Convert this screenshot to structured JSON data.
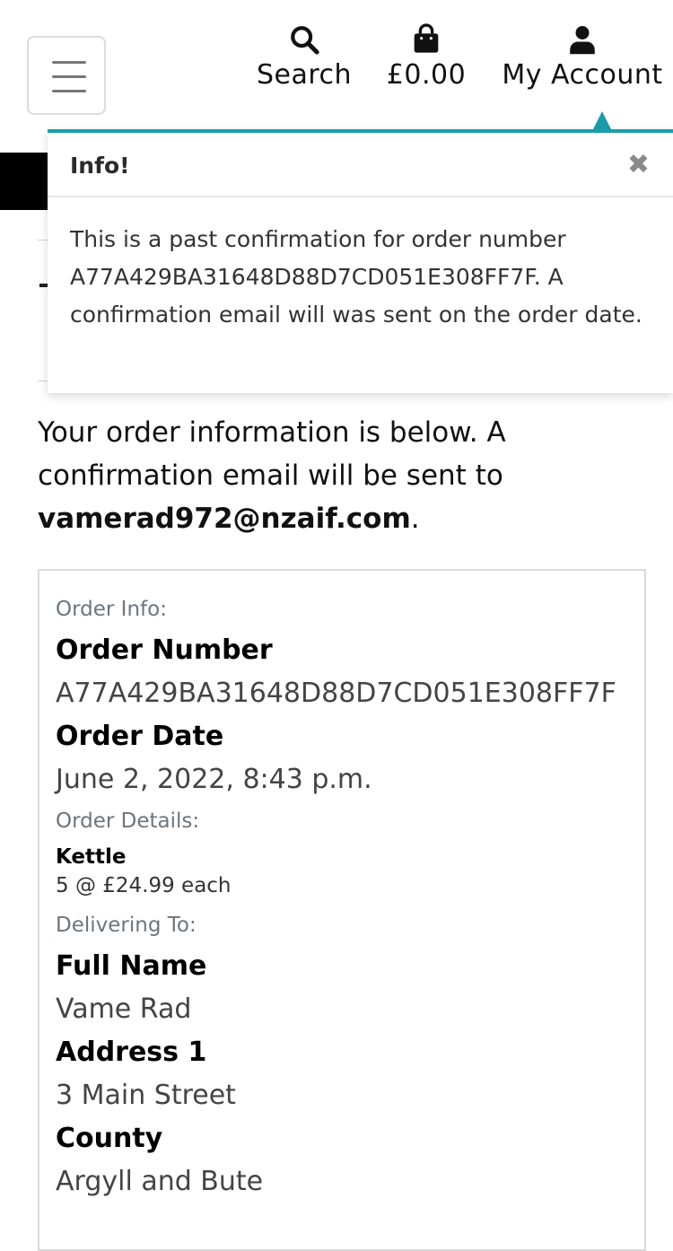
{
  "header": {
    "search_label": "Search",
    "bag_total": "£0.00",
    "account_label": "My Account"
  },
  "toast": {
    "title": "Info!",
    "close_glyph": "✖",
    "message": "This is a past confirmation for order number A77A429BA31648D88D7CD051E308FF7F. A confirmation email will was sent on the order date."
  },
  "intro": {
    "text_before": "Your order information is below. A confirmation email will be sent to ",
    "email": "vamerad972@nzaif.com",
    "text_after": "."
  },
  "order": {
    "order_info_label": "Order Info:",
    "order_number_title": "Order Number",
    "order_number": "A77A429BA31648D88D7CD051E308FF7F",
    "order_date_title": "Order Date",
    "order_date": "June 2, 2022, 8:43 p.m.",
    "order_details_label": "Order Details:",
    "items": [
      {
        "name": "Kettle",
        "qty_text": "5 @ £24.99 each"
      }
    ],
    "delivering_label": "Delivering To:",
    "full_name_title": "Full Name",
    "full_name": "Vame Rad",
    "address1_title": "Address 1",
    "address1": "3 Main Street",
    "county_title": "County",
    "county": "Argyll and Bute"
  },
  "colors": {
    "accent": "#1a9dab",
    "muted": "#6c757d"
  },
  "icons": [
    "menu-icon",
    "search-icon",
    "shopping-bag-icon",
    "user-icon",
    "close-icon"
  ]
}
